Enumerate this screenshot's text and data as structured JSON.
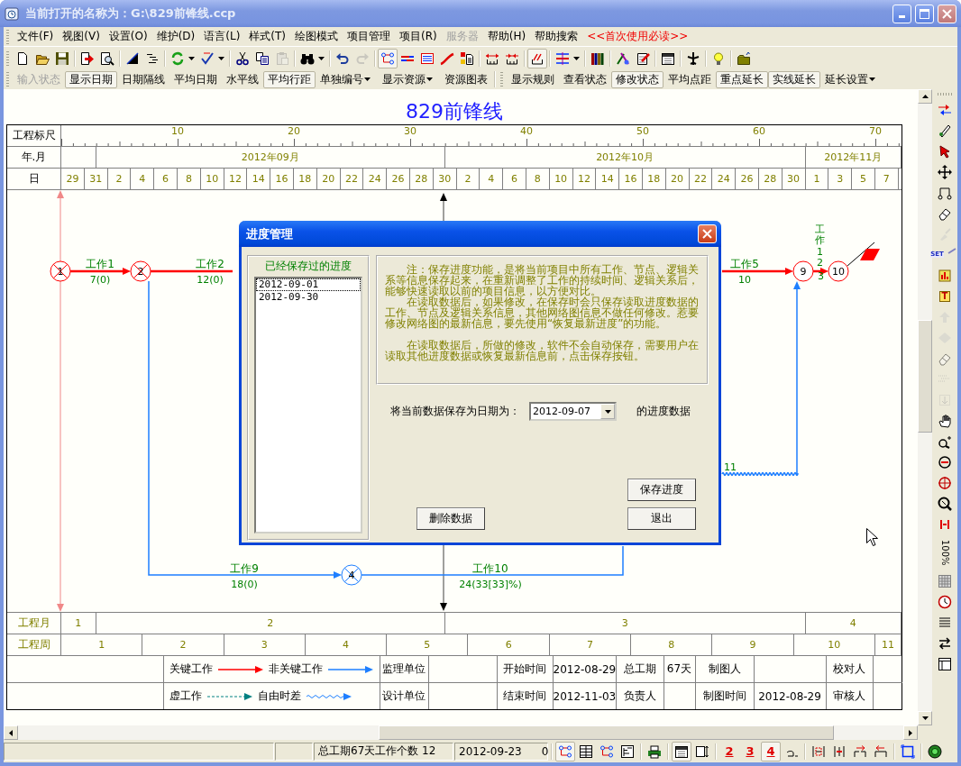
{
  "window": {
    "title": "当前打开的名称为：G:\\829前锋线.ccp"
  },
  "menu": [
    {
      "label": "文件(F)",
      "kind": "menu",
      "disabled": false
    },
    {
      "label": "视图(V)",
      "kind": "menu",
      "disabled": false
    },
    {
      "label": "设置(O)",
      "kind": "menu",
      "disabled": false
    },
    {
      "label": "维护(D)",
      "kind": "menu",
      "disabled": false
    },
    {
      "label": "语言(L)",
      "kind": "menu",
      "disabled": false
    },
    {
      "label": "样式(T)",
      "kind": "menu",
      "disabled": false
    },
    {
      "label": "绘图模式",
      "kind": "menu",
      "disabled": false
    },
    {
      "label": "项目管理",
      "kind": "menu",
      "disabled": false
    },
    {
      "label": "项目(R)",
      "kind": "menu",
      "disabled": false
    },
    {
      "label": "服务器",
      "kind": "menu",
      "disabled": true
    },
    {
      "label": "帮助(H)",
      "kind": "menu",
      "disabled": false
    },
    {
      "label": "帮助搜索",
      "kind": "menu",
      "disabled": false
    },
    {
      "label": "<<首次使用必读>>",
      "kind": "notice",
      "disabled": false
    }
  ],
  "toolbar": [
    {
      "pressed": false,
      "disabled": false
    },
    {
      "pressed": false,
      "disabled": false
    },
    {
      "pressed": false,
      "disabled": false
    },
    {
      "pressed": false,
      "disabled": false
    },
    {
      "pressed": false,
      "disabled": false
    },
    {
      "pressed": false,
      "disabled": false
    },
    {
      "pressed": false,
      "disabled": false
    },
    {
      "pressed": false,
      "disabled": false
    },
    {
      "pressed": false,
      "disabled": false
    },
    {
      "pressed": false,
      "disabled": false
    },
    {
      "pressed": false,
      "disabled": false
    },
    {
      "pressed": false,
      "disabled": true
    },
    {
      "pressed": false,
      "disabled": false
    },
    {
      "pressed": false,
      "disabled": false
    },
    {
      "pressed": false,
      "disabled": true
    },
    {
      "pressed": true,
      "disabled": false
    },
    {
      "pressed": false,
      "disabled": false
    },
    {
      "pressed": false,
      "disabled": false
    },
    {
      "pressed": false,
      "disabled": false
    },
    {
      "pressed": false,
      "disabled": false
    },
    {
      "pressed": false,
      "disabled": false
    },
    {
      "pressed": false,
      "disabled": false
    },
    {
      "pressed": true,
      "disabled": false
    },
    {
      "pressed": false,
      "disabled": false
    },
    {
      "pressed": false,
      "disabled": false
    },
    {
      "pressed": false,
      "disabled": false
    },
    {
      "pressed": false,
      "disabled": false
    },
    {
      "pressed": false,
      "disabled": false
    },
    {
      "pressed": false,
      "disabled": false
    },
    {
      "pressed": false,
      "disabled": false
    },
    {
      "pressed": false,
      "disabled": false
    }
  ],
  "format_bar": [
    {
      "label": "输入状态",
      "pressed": false,
      "disabled": true,
      "dropdown": false
    },
    {
      "label": "显示日期",
      "pressed": true,
      "disabled": false,
      "dropdown": false
    },
    {
      "label": "日期隔线",
      "pressed": false,
      "disabled": false,
      "dropdown": false
    },
    {
      "label": "平均日期",
      "pressed": false,
      "disabled": false,
      "dropdown": false
    },
    {
      "label": "水平线",
      "pressed": false,
      "disabled": false,
      "dropdown": false
    },
    {
      "label": "平均行距",
      "pressed": true,
      "disabled": false,
      "dropdown": false
    },
    {
      "label": "单独编号",
      "pressed": false,
      "disabled": false,
      "dropdown": true
    },
    {
      "label": "显示资源",
      "pressed": false,
      "disabled": false,
      "dropdown": true
    },
    {
      "label": "资源图表",
      "pressed": false,
      "disabled": false,
      "dropdown": false
    }
  ],
  "state_bar": [
    {
      "label": "显示规则",
      "pressed": false,
      "disabled": false,
      "dropdown": false
    },
    {
      "label": "查看状态",
      "pressed": false,
      "disabled": false,
      "dropdown": false
    },
    {
      "label": "修改状态",
      "pressed": true,
      "disabled": false,
      "dropdown": false
    },
    {
      "label": "平均点距",
      "pressed": false,
      "disabled": false,
      "dropdown": false
    },
    {
      "label": "重点延长",
      "pressed": true,
      "disabled": false,
      "dropdown": false
    },
    {
      "label": "实线延长",
      "pressed": true,
      "disabled": false,
      "dropdown": false
    },
    {
      "label": "延长设置",
      "pressed": false,
      "disabled": false,
      "dropdown": true
    }
  ],
  "chart": {
    "title": "829前锋线",
    "ruler_label": "工程标尺",
    "ruler_ticks": [
      "10",
      "20",
      "30",
      "40",
      "50",
      "60",
      "70"
    ],
    "month_label": "年.月",
    "months": [
      "2012年09月",
      "2012年10月",
      "2012年11月"
    ],
    "day_label": "日",
    "days": [
      "29",
      "31",
      "2",
      "4",
      "6",
      "8",
      "10",
      "12",
      "14",
      "16",
      "18",
      "20",
      "22",
      "24",
      "26",
      "28",
      "30",
      "2",
      "4",
      "6",
      "8",
      "10",
      "12",
      "14",
      "16",
      "18",
      "20",
      "22",
      "24",
      "26",
      "28",
      "30",
      "1",
      "3",
      "5",
      "7"
    ],
    "network": {
      "nodes": [
        {
          "label": "1",
          "critical": true,
          "crossed": true
        },
        {
          "label": "2",
          "critical": true,
          "crossed": true
        },
        {
          "label": "4",
          "critical": false,
          "crossed": true
        },
        {
          "label": "9",
          "critical": true,
          "crossed": false
        },
        {
          "label": "10",
          "critical": true,
          "crossed": false
        }
      ],
      "works": [
        {
          "name": "工作1",
          "duration": "7(0)",
          "critical": true,
          "kind": "solid"
        },
        {
          "name": "工作2",
          "duration": "12(0)",
          "critical": true,
          "kind": "solid"
        },
        {
          "name": "工作5",
          "duration": "10",
          "critical": true,
          "kind": "solid"
        },
        {
          "name": "工作9",
          "duration": "18(0)",
          "critical": false,
          "kind": "solid"
        },
        {
          "name": "工作10",
          "duration": "24(33[33]%)",
          "critical": false,
          "kind": "solid"
        },
        {
          "name": "工作12",
          "duration": "3",
          "critical": true,
          "kind": "solid"
        },
        {
          "duration": "11",
          "critical": false,
          "kind": "wavy"
        }
      ]
    },
    "project_month_label": "工程月",
    "project_months": [
      "1",
      "2",
      "3",
      "4"
    ],
    "project_week_label": "工程周",
    "project_weeks": [
      "1",
      "2",
      "3",
      "4",
      "5",
      "6",
      "7",
      "8",
      "9",
      "10",
      "11"
    ],
    "legend": {
      "items": [
        {
          "label": "关键工作",
          "kind": "critical"
        },
        {
          "label": "非关键工作",
          "kind": "normal"
        },
        {
          "label": "虚工作",
          "kind": "dummy"
        },
        {
          "label": "自由时差",
          "kind": "float"
        }
      ],
      "rows": [
        {
          "unit": "监理单位",
          "date_label": "开始时间",
          "date": "2012-08-29",
          "field_a": "总工期",
          "value_a": "67天",
          "field_b": "制图人",
          "field_c": "校对人"
        },
        {
          "unit": "设计单位",
          "date_label": "结束时间",
          "date": "2012-11-03",
          "field_a": "负责人",
          "field_b": "制图时间",
          "value_b": "2012-08-29",
          "field_c": "审核人"
        }
      ]
    }
  },
  "dialog": {
    "title": "进度管理",
    "list_label": "已经保存过的进度",
    "saved": [
      {
        "label": "2012-09-01",
        "selected": true
      },
      {
        "label": "2012-09-30",
        "selected": false
      }
    ],
    "notes": [
      "注：保存进度功能，是将当前项目中所有工作、节点、逻辑关系等信息保存起来，在重新调整了工作的持续时间、逻辑关系后，能够快速读取以前的项目信息，以方便对比。",
      "在读取数据后，如果修改，在保存时会只保存读取进度数据的工作、节点及逻辑关系信息，其他网络图信息不做任何修改。惹要修改网络图的最新信息，要先使用“恢复最新进度”的功能。",
      "在读取数据后，所做的修改，软件不会自动保存，需要用户在读取其他进度数据或恢复最新信息前，点击保存按钮。"
    ],
    "date_label": "将当前数据保存为日期为：",
    "date_value": "2012-09-07",
    "date_suffix": "的进度数据",
    "buttons": [
      "删除数据",
      "保存进度",
      "退出"
    ]
  },
  "side_tools": [
    {
      "kind": "icon",
      "disabled": false
    },
    {
      "kind": "icon",
      "disabled": false
    },
    {
      "kind": "icon",
      "disabled": false
    },
    {
      "kind": "icon",
      "disabled": false
    },
    {
      "kind": "icon",
      "disabled": false
    },
    {
      "kind": "icon",
      "disabled": false
    },
    {
      "kind": "icon",
      "disabled": true
    },
    {
      "kind": "icon",
      "label": "SET",
      "disabled": false
    },
    {
      "kind": "icon",
      "disabled": false
    },
    {
      "kind": "icon",
      "label": "T",
      "disabled": false
    },
    {
      "kind": "icon",
      "disabled": true
    },
    {
      "kind": "icon",
      "disabled": true
    },
    {
      "kind": "icon",
      "disabled": true
    },
    {
      "kind": "icon",
      "disabled": true
    },
    {
      "kind": "icon",
      "disabled": true
    },
    {
      "kind": "icon",
      "disabled": false
    },
    {
      "kind": "icon",
      "disabled": false
    },
    {
      "kind": "icon",
      "disabled": false
    },
    {
      "kind": "icon",
      "disabled": false
    },
    {
      "kind": "icon",
      "disabled": false
    },
    {
      "kind": "icon",
      "disabled": false
    },
    {
      "kind": "text",
      "label": "100%",
      "disabled": false
    },
    {
      "kind": "icon",
      "disabled": false
    },
    {
      "kind": "icon",
      "disabled": false
    },
    {
      "kind": "icon",
      "disabled": false
    },
    {
      "kind": "icon",
      "disabled": false
    },
    {
      "kind": "icon",
      "disabled": false
    }
  ],
  "status_bar": {
    "summary": "总工期67天工作个数 12",
    "date": "2012-09-23",
    "count": "0",
    "tools": [
      {
        "pressed": true
      },
      {
        "pressed": false
      },
      {
        "pressed": false
      },
      {
        "pressed": false
      },
      {
        "pressed": false
      },
      {
        "pressed": true
      },
      {
        "pressed": false
      },
      {
        "label": "2",
        "pressed": false
      },
      {
        "label": "3",
        "pressed": false
      },
      {
        "label": "4",
        "pressed": true
      },
      {
        "pressed": false
      },
      {
        "pressed": false
      },
      {
        "pressed": false
      },
      {
        "pressed": false
      },
      {
        "pressed": false
      },
      {
        "pressed": false
      },
      {
        "pressed": false
      }
    ]
  }
}
